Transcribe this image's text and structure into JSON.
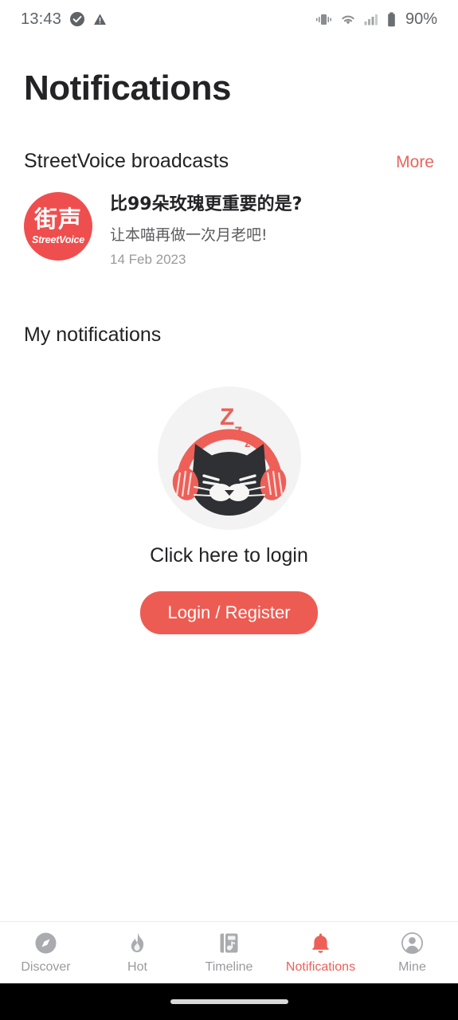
{
  "statusbar": {
    "time": "13:43",
    "battery_percent": "90%",
    "icons": [
      "check-circle-icon",
      "warning-triangle-icon",
      "vibrate-icon",
      "wifi-icon",
      "cell-signal-icon",
      "battery-icon"
    ]
  },
  "header": {
    "title": "Notifications"
  },
  "broadcast_section": {
    "title": "StreetVoice broadcasts",
    "more_label": "More",
    "item": {
      "logo_cn": "街声",
      "logo_en": "StreetVoice",
      "title": "比99朵玫瑰更重要的是?",
      "subtitle": "让本喵再做一次月老吧!",
      "date": "14 Feb 2023"
    }
  },
  "my_notifications": {
    "title": "My notifications",
    "empty_text": "Click here to login",
    "login_button": "Login / Register",
    "illustration": "sleeping-cat-with-headphones",
    "sleep_letters": [
      "Z",
      "z",
      "z"
    ]
  },
  "bottom_nav": {
    "items": [
      {
        "label": "Discover",
        "icon": "compass-icon",
        "active": false
      },
      {
        "label": "Hot",
        "icon": "flame-icon",
        "active": false
      },
      {
        "label": "Timeline",
        "icon": "music-book-icon",
        "active": false
      },
      {
        "label": "Notifications",
        "icon": "bell-icon",
        "active": true
      },
      {
        "label": "Mine",
        "icon": "person-circle-icon",
        "active": false
      }
    ]
  },
  "colors": {
    "accent_red": "#ed5c52",
    "link_red": "#e8655e",
    "logo_red": "#ef4e4e",
    "text_primary": "#232326",
    "text_secondary": "#5c5c5f",
    "text_muted": "#9a9a9e"
  }
}
